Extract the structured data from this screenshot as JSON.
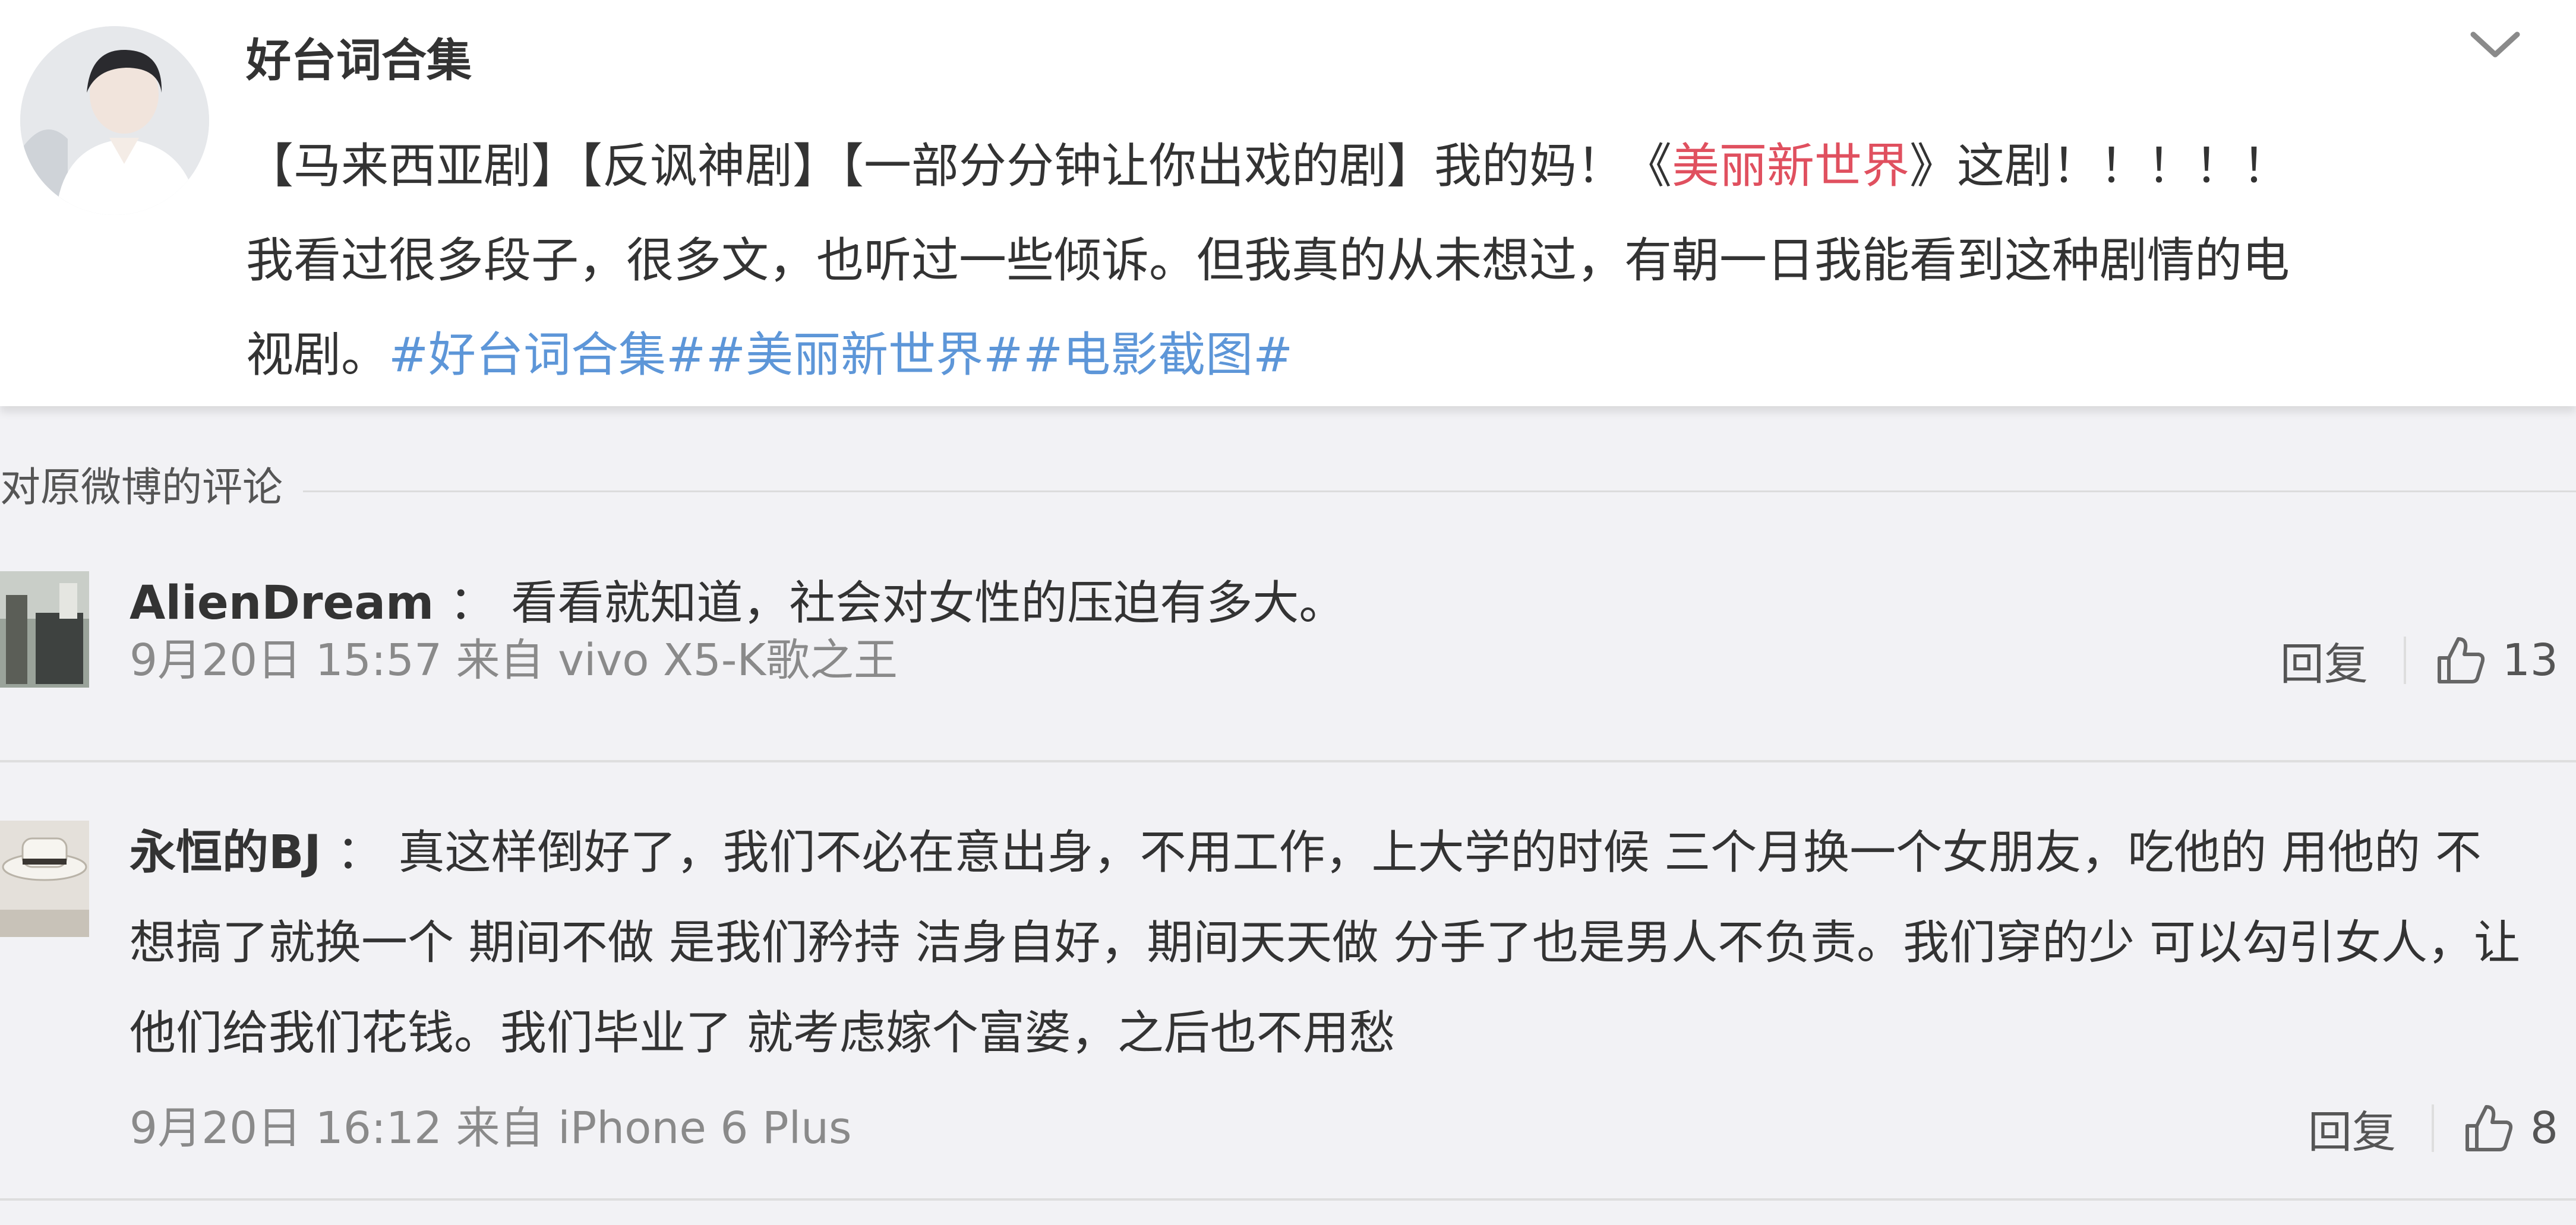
{
  "post": {
    "author": "好台词合集",
    "line1": {
      "pre": "【马来西亚剧】【反讽神剧】【一部分分钟让你出戏的剧】我的妈！《",
      "title": "美丽新世界",
      "post": "》这剧！！！！！"
    },
    "line2": "我看过很多段子，很多文，也听过一些倾诉。但我真的从未想过，有朝一日我能看到这种剧情的电",
    "line3": {
      "pre": "视剧。",
      "hashtags": "#好台词合集##美丽新世界##电影截图#"
    }
  },
  "comments_section": {
    "title": "对原微博的评论"
  },
  "comments": [
    {
      "user": "AlienDream",
      "separator": "：",
      "text": "看看就知道，社会对女性的压迫有多大。",
      "meta": "9月20日 15:57 来自 vivo X5-K歌之王",
      "reply_label": "回复",
      "likes": "13"
    },
    {
      "user": "永恒的BJ",
      "separator": "：",
      "text_lines": [
        "真这样倒好了，我们不必在意出身，不用工作，上大学的时候 三个月换一个女朋友，吃他的 用他的 不",
        "想搞了就换一个 期间不做 是我们矜持 洁身自好，期间天天做 分手了也是男人不负责。我们穿的少 可以勾引女人，让",
        "他们给我们花钱。我们毕业了 就考虑嫁个富婆，之后也不用愁"
      ],
      "meta": "9月20日 16:12 来自 iPhone 6 Plus",
      "reply_label": "回复",
      "likes": "8"
    }
  ],
  "icons": {
    "collapse": "chevron-down-icon",
    "like": "thumbs-up-icon"
  },
  "colors": {
    "accent_link": "#5d96d8",
    "title_link": "#e0505f",
    "meta_text": "#8a8a8a",
    "background": "#f2f2f5"
  }
}
